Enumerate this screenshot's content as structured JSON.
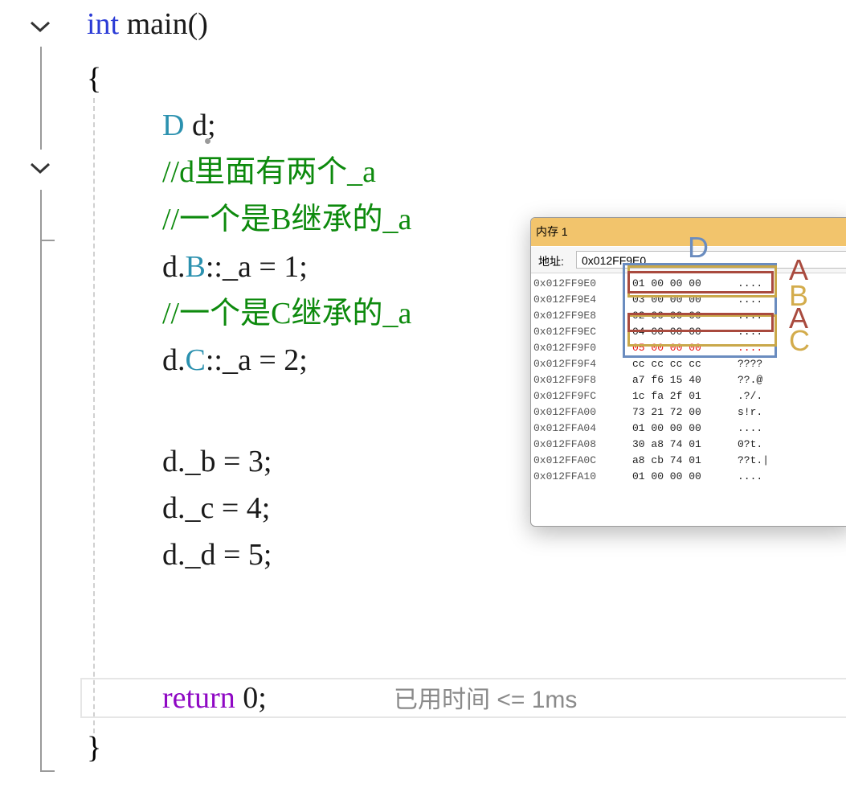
{
  "code": {
    "line1": {
      "kw": "int",
      "rest": " main()"
    },
    "line2": "{",
    "line3": {
      "type": "D",
      "rest": " d;"
    },
    "line4": "//d里面有两个_a",
    "line5": "//一个是B继承的_a",
    "line6": {
      "a": "d.",
      "b": "B",
      "c": "::_a = 1;"
    },
    "line7": "//一个是C继承的_a",
    "line8": {
      "a": "d.",
      "b": "C",
      "c": "::_a = 2;"
    },
    "line9": "d._b = 3;",
    "line10": "d._c = 4;",
    "line11": "d._d = 5;",
    "line12": {
      "kw": "return",
      "rest": " 0;"
    },
    "line13": "}",
    "elapsed_hint": "已用时间 <= 1ms"
  },
  "memory_window": {
    "title": "内存 1",
    "address_label": "地址:",
    "address_value": "0x012FF9E0",
    "rows": [
      {
        "addr": "0x012FF9E0",
        "bytes": "01 00 00 00",
        "ascii": "....",
        "changed": false
      },
      {
        "addr": "0x012FF9E4",
        "bytes": "03 00 00 00",
        "ascii": "....",
        "changed": false
      },
      {
        "addr": "0x012FF9E8",
        "bytes": "02 00 00 00",
        "ascii": "....",
        "changed": false
      },
      {
        "addr": "0x012FF9EC",
        "bytes": "04 00 00 00",
        "ascii": "....",
        "changed": false
      },
      {
        "addr": "0x012FF9F0",
        "bytes": "05 00 00 00",
        "ascii": "....",
        "changed": true
      },
      {
        "addr": "0x012FF9F4",
        "bytes": "cc cc cc cc",
        "ascii": "????",
        "changed": false
      },
      {
        "addr": "0x012FF9F8",
        "bytes": "a7 f6 15 40",
        "ascii": "??.@",
        "changed": false
      },
      {
        "addr": "0x012FF9FC",
        "bytes": "1c fa 2f 01",
        "ascii": ".?/.",
        "changed": false
      },
      {
        "addr": "0x012FFA00",
        "bytes": "73 21 72 00",
        "ascii": "s!r.",
        "changed": false
      },
      {
        "addr": "0x012FFA04",
        "bytes": "01 00 00 00",
        "ascii": "....",
        "changed": false
      },
      {
        "addr": "0x012FFA08",
        "bytes": "30 a8 74 01",
        "ascii": "0?t.",
        "changed": false
      },
      {
        "addr": "0x012FFA0C",
        "bytes": "a8 cb 74 01",
        "ascii": "??t.|",
        "changed": false
      },
      {
        "addr": "0x012FFA10",
        "bytes": "01 00 00 00",
        "ascii": "....",
        "changed": false
      }
    ]
  },
  "annotations": {
    "label_D": "D",
    "label_A1": "A",
    "label_B": "B",
    "label_A2": "A",
    "label_C": "C",
    "colors": {
      "A": "#a94a3e",
      "B": "#c9a84a",
      "C": "#c9a84a",
      "D": "#6a8cbf"
    }
  }
}
